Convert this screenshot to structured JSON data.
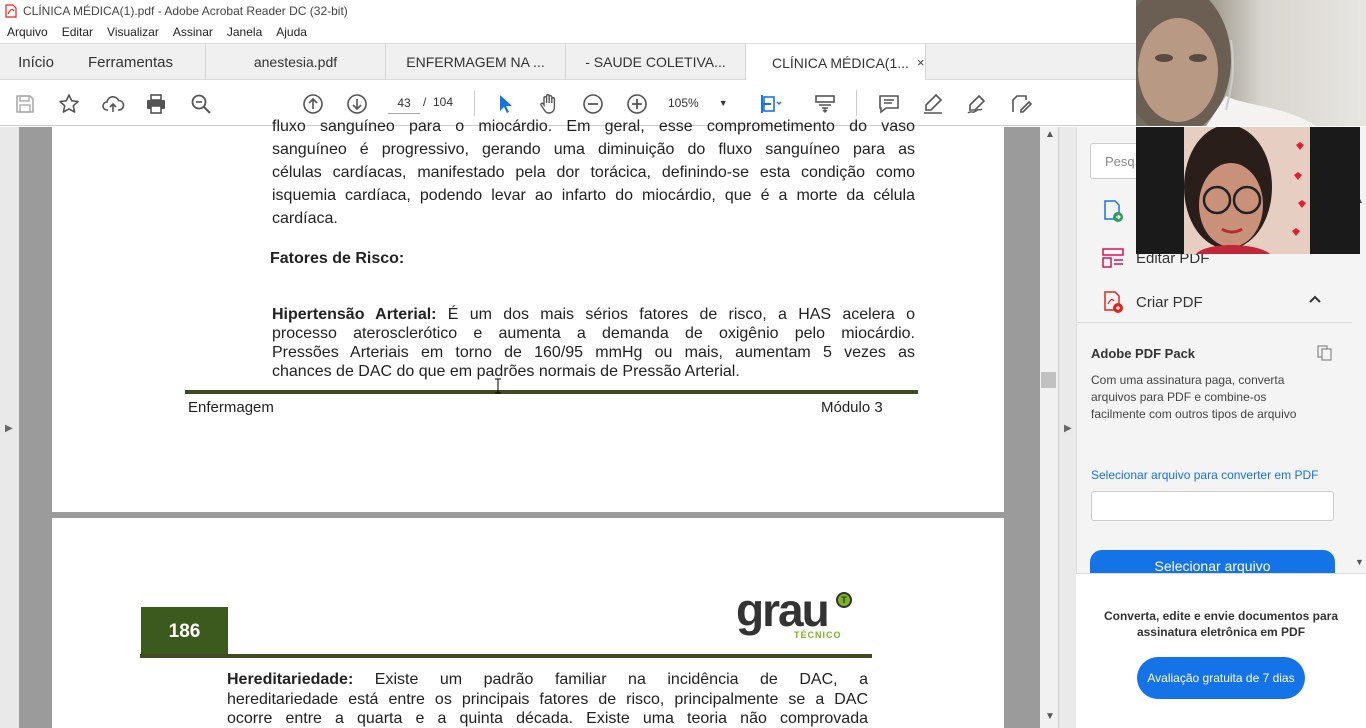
{
  "window": {
    "title": "CLÍNICA MÉDICA(1).pdf - Adobe Acrobat Reader DC (32-bit)"
  },
  "menu": [
    "Arquivo",
    "Editar",
    "Visualizar",
    "Assinar",
    "Janela",
    "Ajuda"
  ],
  "tabs": {
    "home": "Início",
    "tools": "Ferramentas",
    "docs": [
      "anestesia.pdf",
      "ENFERMAGEM NA ...",
      "- SAUDE COLETIVA...",
      "CLÍNICA MÉDICA(1..."
    ],
    "close": "×"
  },
  "toolbar": {
    "page_current": "43",
    "page_sep": "/",
    "page_total": "104",
    "zoom": "105%"
  },
  "page1": {
    "lines": [
      "fluxo sanguíneo para o miocárdio. Em geral, esse comprometimento do vaso",
      "sanguíneo é progressivo, gerando uma diminuição do fluxo sanguíneo para as",
      "células cardíacas, manifestado pela dor torácica, definindo-se esta condição como",
      "isquemia cardíaca, podendo levar ao infarto do miocárdio, que é a morte da célula",
      "cardíaca."
    ],
    "heading": "Fatores de Risco:",
    "hyp_label": "Hipertensão Arterial:",
    "hyp_first": " É um dos mais sérios fatores de risco, a HAS acelera o",
    "hyp_lines": [
      "processo aterosclerótico e aumenta a demanda de oxigênio pelo miocárdio.",
      "Pressões Arteriais em torno de 160/95 mmHg ou mais, aumentam 5 vezes as",
      "chances de DAC do que em padrões normais de Pressão Arterial."
    ],
    "footer_left": "Enfermagem",
    "footer_right": "Módulo 3"
  },
  "page2": {
    "page_number": "186",
    "logo_main": "grau",
    "logo_sub": "TÉCNICO",
    "logo_mark": "T",
    "her_label": "Hereditariedade:",
    "her_first": " Existe um padrão familiar na incidência de DAC, a",
    "her_lines": [
      "hereditariedade está entre os principais fatores de risco, principalmente se a DAC",
      "ocorre entre a quarta e a quinta década. Existe uma teoria não comprovada"
    ]
  },
  "rightpane": {
    "search_placeholder": "Pesq",
    "items": {
      "edit": "Editar PDF",
      "create": "Criar PDF"
    },
    "pack_title": "Adobe PDF Pack",
    "pack_desc": "Com uma assinatura paga, converta arquivos para PDF e combine-os facilmente com outros tipos de arquivo",
    "pack_link": "Selecionar arquivo para converter em PDF",
    "pack_button": "Selecionar arquivo",
    "promo": "Converta, edite e envie documentos para assinatura eletrônica em PDF",
    "trial_button": "Avaliação gratuita de 7 dias"
  },
  "colors": {
    "accent": "#1473e6",
    "page_green": "#3d5a1e",
    "logo_green": "#7ab51d",
    "pdf_red": "#e0261b"
  }
}
